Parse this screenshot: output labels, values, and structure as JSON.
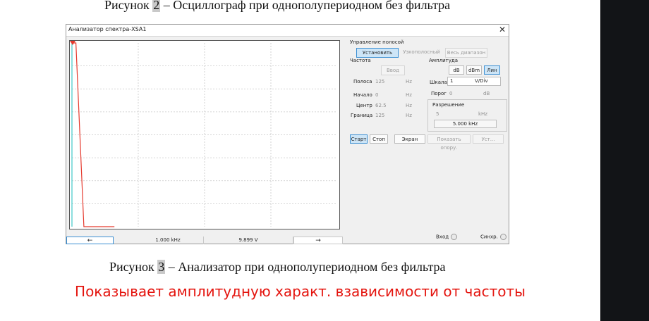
{
  "doc": {
    "caption_top": {
      "prefix": "Рисунок ",
      "num": "2",
      "suffix": " – Осциллограф при однополупериодном без фильтра"
    },
    "caption_bottom": {
      "prefix": "Рисунок ",
      "num": "3",
      "suffix": " – Анализатор при однополупериодном без фильтра"
    },
    "note": "Показывает амплитудную характ. взависимости от частоты"
  },
  "window": {
    "title": "Анализатор спектра-XSA1",
    "close": "✕"
  },
  "band_control": {
    "heading": "Управление полосой",
    "set": "Установить",
    "narrow": "Узкополосный",
    "full": "Весь диапазон"
  },
  "frequency": {
    "heading": "Частота",
    "enter": "Ввод",
    "rows": [
      {
        "label": "Полоса",
        "value": "125",
        "unit": "Hz"
      },
      {
        "label": "Начало",
        "value": "0",
        "unit": "Hz"
      },
      {
        "label": "Центр",
        "value": "62.5",
        "unit": "Hz"
      },
      {
        "label": "Граница",
        "value": "125",
        "unit": "Hz"
      }
    ]
  },
  "amplitude": {
    "heading": "Амплитуда",
    "db": "dB",
    "dbm": "dBm",
    "lin": "Лин",
    "scale_label": "Шкала",
    "scale_value": "1",
    "scale_unit": "V/Div",
    "threshold_label": "Порог",
    "threshold_value": "0",
    "threshold_unit": "dB"
  },
  "resolution": {
    "heading": "Разрешение",
    "value": "5",
    "unit": "kHz",
    "display": "5.000 kHz"
  },
  "controls": {
    "start": "Старт",
    "stop": "Стоп",
    "screen": "Экран",
    "show_ref": "Показать опору.",
    "settings": "Уст..."
  },
  "readout": {
    "left_arrow": "←",
    "freq": "1.000 kHz",
    "voltage": "9.899  V",
    "right_arrow": "→"
  },
  "io": {
    "input": "Вход",
    "sync": "Синхр."
  },
  "chart_data": {
    "type": "line",
    "series": [
      {
        "x_frac": [
          0.0,
          0.015,
          0.045,
          0.16
        ],
        "y_frac": [
          1.0,
          1.0,
          0.0,
          0.0
        ],
        "color": "#e53a2e"
      },
      {
        "x_frac": [
          0.0,
          0.0
        ],
        "y_frac": [
          0.0,
          1.0
        ],
        "color": "#41c7c7"
      }
    ],
    "grid": true,
    "grid_cols": 4,
    "grid_rows": 8
  }
}
